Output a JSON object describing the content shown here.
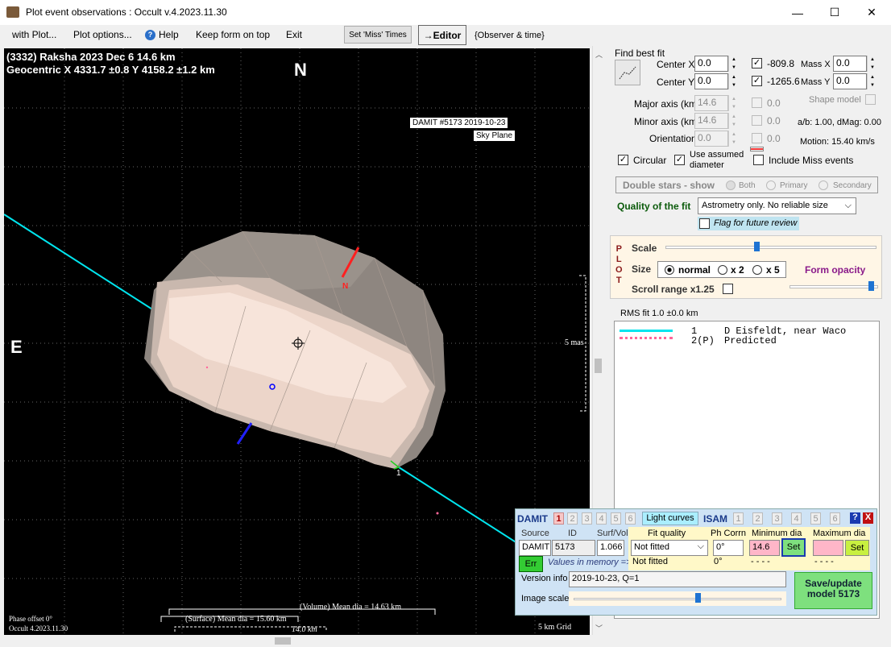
{
  "window": {
    "title": "Plot event observations : Occult v.4.2023.11.30",
    "minimize": "—",
    "maximize": "☐",
    "close": "✕"
  },
  "menu": {
    "with_plot": "with Plot...",
    "plot_options": "Plot options...",
    "help": "Help",
    "keep_on_top": "Keep form on top",
    "exit": "Exit",
    "set_miss": "Set 'Miss' Times",
    "editor": "→Editor",
    "observer_time": "{Observer & time}"
  },
  "plot": {
    "title_line1": "(3332) Raksha  2023 Dec 6   14.6 km",
    "title_line2": "Geocentric  X  4331.7 ±0.8  Y 4158.2 ±1.2 km",
    "north": "N",
    "east": "E",
    "damit_label1": "DAMIT #5173 2019-10-23",
    "damit_label2": "Sky Plane",
    "scale_mas": "5 mas",
    "phase_offset": "Phase offset 0°",
    "occult_ver": "Occult 4.2023.11.30",
    "volume_dia": "(Volume) Mean dia = 14.63 km",
    "surface_dia": "(Surface) Mean dia = 15.60 km",
    "dia_14": "14.0 km",
    "grid": "5 km Grid",
    "chord_num": "1",
    "marker_n": "N"
  },
  "fit": {
    "find_best_fit": "Find best fit",
    "center_x_label": "Center X",
    "center_x": "0.0",
    "center_y_label": "Center Y",
    "center_y": "0.0",
    "cx_val": "-809.8",
    "cy_val": "-1265.6",
    "mass_x_label": "Mass X",
    "mass_x": "0.0",
    "mass_y_label": "Mass Y",
    "mass_y": "0.0",
    "major_label": "Major axis (km)",
    "major": "14.6",
    "major_c": "0.0",
    "minor_label": "Minor axis (km)",
    "minor": "14.6",
    "minor_c": "0.0",
    "orient_label": "Orientation",
    "orient": "0.0",
    "orient_c": "0.0",
    "shape_model": "Shape model",
    "ab_dmag": "a/b: 1.00, dMag: 0.00",
    "motion": "Motion: 15.40 km/s",
    "circular": "Circular",
    "use_assumed": "Use assumed",
    "diameter": "diameter",
    "include_miss": "Include Miss events",
    "double_stars": "Double stars - show",
    "both": "Both",
    "primary": "Primary",
    "secondary": "Secondary",
    "quality_label": "Quality of the fit",
    "quality_value": "Astrometry only. No reliable size",
    "flag_review": "Flag for future review"
  },
  "plotctl": {
    "plot_letters": [
      "P",
      "L",
      "O",
      "T"
    ],
    "scale": "Scale",
    "size": "Size",
    "normal": "normal",
    "x2": "x 2",
    "x5": "x 5",
    "form_opacity": "Form opacity",
    "scroll_range": "Scroll range x1.25",
    "scale_level": 0.43,
    "opacity_level": 0.95
  },
  "rms": "RMS fit 1.0 ±0.0 km",
  "legend": [
    {
      "num": "1",
      "name": "D Eisfeldt, near Waco",
      "color": "#00e5ee"
    },
    {
      "num": "2(P)",
      "name": "Predicted",
      "color": "#ff6699"
    }
  ],
  "damit": {
    "damit": "DAMIT",
    "tabs": [
      "1",
      "2",
      "3",
      "4",
      "5",
      "6"
    ],
    "light_curves": "Light curves",
    "isam": "ISAM",
    "isam_tabs": [
      "1",
      "2",
      "3",
      "4",
      "5",
      "6"
    ],
    "help": "?",
    "close": "X",
    "source_h": "Source",
    "id_h": "ID",
    "surf_h": "Surf/Vol",
    "source": "DAMIT",
    "id": "5173",
    "surf": "1.066",
    "err": "Err",
    "values_mem": "Values in memory =>",
    "fit_quality_h": "Fit quality",
    "fit_quality": "Not fitted",
    "fit_quality2": "Not fitted",
    "ph_corr_h": "Ph Corrn",
    "ph_corr": "0°",
    "ph_corr2": "0°",
    "min_dia_h": "Minimum dia",
    "min_dia": "14.6",
    "min_dash": "- - - -",
    "max_dia_h": "Maximum dia",
    "max_dia": "",
    "max_dash": "- - - -",
    "set": "Set",
    "version_label": "Version info",
    "version": "2019-10-23, Q=1",
    "image_scale": "Image scale",
    "save": "Save/update model 5173",
    "image_scale_level": 0.6
  },
  "colors": {
    "chord": "#00e5ee",
    "north_marker": "#ff2020",
    "south_marker": "#2020ff",
    "green_btn": "#7ee07e",
    "pink": "#ffb6c8"
  }
}
